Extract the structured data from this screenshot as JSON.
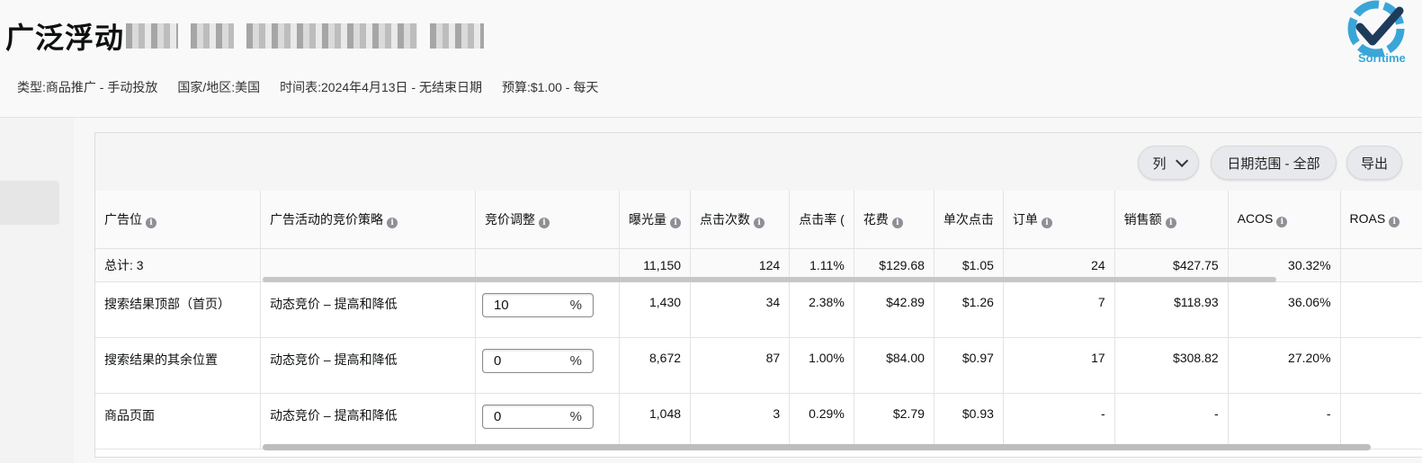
{
  "campaign": {
    "title": "广泛浮动",
    "meta": [
      "类型:商品推广 - 手动投放",
      "国家/地区:美国",
      "时间表:2024年4月13日 - 无结束日期",
      "预算:$1.00 - 每天"
    ]
  },
  "logo": {
    "text": "Sorftime",
    "colors": {
      "ring": "#3aa6d8",
      "check": "#1f3b5c"
    }
  },
  "toolbar": {
    "columns_label": "列",
    "date_range_label": "日期范围 - 全部",
    "export_label": "导出"
  },
  "table": {
    "headers": [
      "广告位",
      "广告活动的竞价策略",
      "竞价调整",
      "曝光量",
      "点击次数",
      "点击率 (",
      "花费",
      "单次点击",
      "订单",
      "销售额",
      "ACOS",
      "ROAS"
    ],
    "total": {
      "label": "总计: 3",
      "impressions": "11,150",
      "clicks": "124",
      "ctr": "1.11%",
      "spend": "$129.68",
      "cpc": "$1.05",
      "orders": "24",
      "sales": "$427.75",
      "acos": "30.32%"
    },
    "rows": [
      {
        "placement": "搜索结果顶部（首页）",
        "strategy": "动态竞价 – 提高和降低",
        "bid": "10",
        "impressions": "1,430",
        "clicks": "34",
        "ctr": "2.38%",
        "spend": "$42.89",
        "cpc": "$1.26",
        "orders": "7",
        "sales": "$118.93",
        "acos": "36.06%"
      },
      {
        "placement": "搜索结果的其余位置",
        "strategy": "动态竞价 – 提高和降低",
        "bid": "0",
        "impressions": "8,672",
        "clicks": "87",
        "ctr": "1.00%",
        "spend": "$84.00",
        "cpc": "$0.97",
        "orders": "17",
        "sales": "$308.82",
        "acos": "27.20%"
      },
      {
        "placement": "商品页面",
        "strategy": "动态竞价 – 提高和降低",
        "bid": "0",
        "impressions": "1,048",
        "clicks": "3",
        "ctr": "0.29%",
        "spend": "$2.79",
        "cpc": "$0.93",
        "orders": "-",
        "sales": "-",
        "acos": "-"
      }
    ],
    "percent_suffix": "%"
  }
}
